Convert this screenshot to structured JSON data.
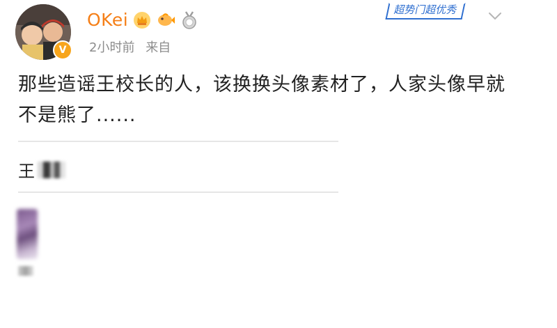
{
  "header": {
    "username": "OKei",
    "time": "2小时前",
    "source": "来自",
    "follow_tag": "超势门超优秀",
    "verified_mark": "V",
    "badge_icons": [
      "crown-badge-icon",
      "fish-badge-icon",
      "medal-badge-icon"
    ]
  },
  "post": {
    "text": "那些造谣王校长的人，该换换头像素材了，人家头像早就不是熊了......",
    "quoted_name": "王"
  },
  "colors": {
    "username": "#f57f17",
    "accent_blue": "#2f6fd0",
    "meta_gray": "#8c8c8c",
    "text": "#222222"
  }
}
